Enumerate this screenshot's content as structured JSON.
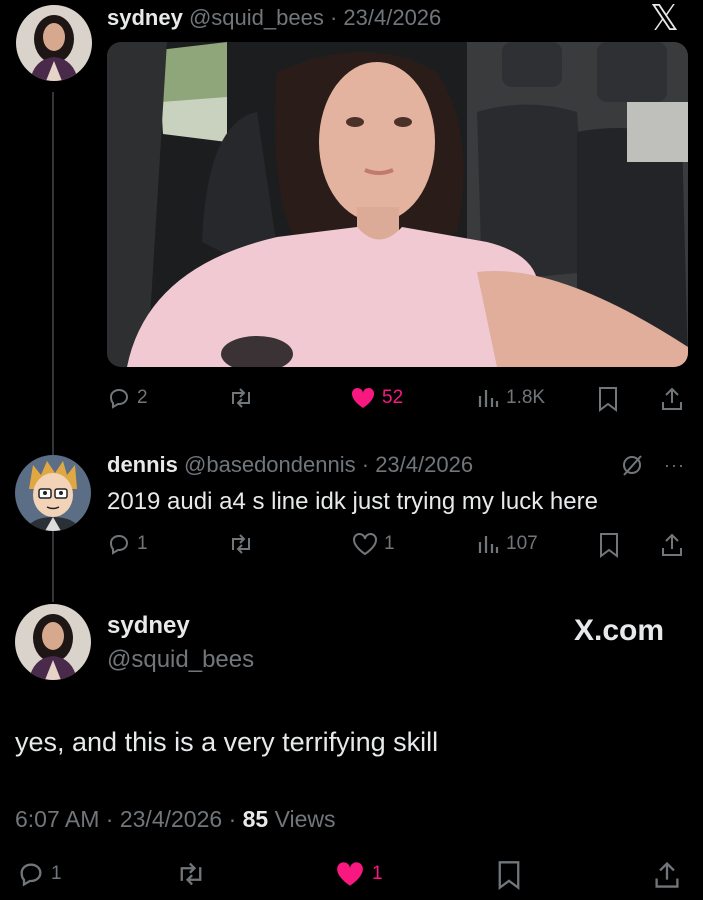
{
  "post1": {
    "name": "sydney",
    "handle": "@squid_bees",
    "sep": "·",
    "date": "23/4/2026",
    "replies": "2",
    "likes": "52",
    "views": "1.8K"
  },
  "post2": {
    "name": "dennis",
    "handle": "@basedondennis",
    "sep": "·",
    "date": "23/4/2026",
    "text": "2019 audi a4 s line idk just trying my luck here",
    "replies": "1",
    "likes": "1",
    "views": "107",
    "more": "···"
  },
  "post3": {
    "name": "sydney",
    "handle": "@squid_bees",
    "text": "yes, and this is a very terrifying skill",
    "time": "6:07 AM",
    "sep1": "·",
    "date": "23/4/2026",
    "sep2": "·",
    "views_count": "85",
    "views_label": "Views",
    "replies": "1",
    "likes": "1"
  },
  "watermark": {
    "top_logo": "𝕏",
    "site": "X.com"
  },
  "colors": {
    "background": "#000000",
    "text": "#e7e9ea",
    "muted": "#71767b",
    "like": "#f91880",
    "thread_line": "#333639"
  },
  "icons": [
    "reply-icon",
    "retweet-icon",
    "heart-icon",
    "views-icon",
    "bookmark-icon",
    "share-icon",
    "grok-icon"
  ]
}
